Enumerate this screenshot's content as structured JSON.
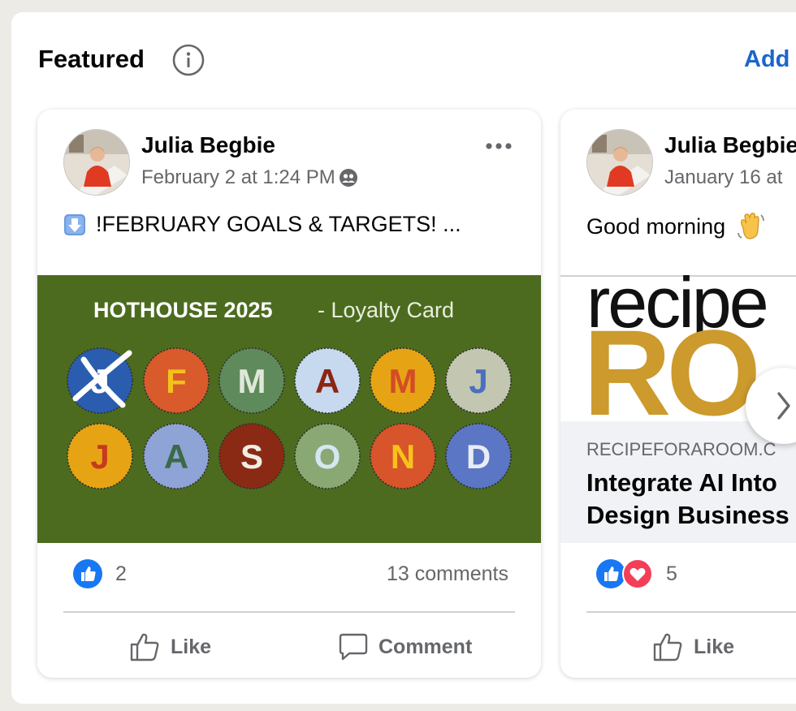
{
  "header": {
    "title": "Featured",
    "info_icon": "info-icon",
    "add_label": "Add"
  },
  "cards": [
    {
      "author": "Julia Begbie",
      "date": "February 2 at 1:24 PM",
      "privacy_icon": "friends-icon",
      "text": "!FEBRUARY GOALS & TARGETS! ...",
      "text_emoji_icon": "down-arrow-emoji",
      "media": {
        "title_bold": "HOTHOUSE 2025",
        "title_rest": "- Loyalty Card",
        "background": "#4c6b1f",
        "months": [
          {
            "letter": "J",
            "color": "#2a5db0",
            "text": "#2a5db0",
            "crossed": true
          },
          {
            "letter": "F",
            "color": "#d95a2b",
            "text": "#f2c11c"
          },
          {
            "letter": "M",
            "color": "#5f8a5c",
            "text": "#dfe8d8"
          },
          {
            "letter": "A",
            "color": "#c7d9ef",
            "text": "#8b2612"
          },
          {
            "letter": "M",
            "color": "#e6a414",
            "text": "#d24d26"
          },
          {
            "letter": "J",
            "color": "#c3c6b0",
            "text": "#4a6ec0"
          },
          {
            "letter": "J",
            "color": "#e6a414",
            "text": "#c63a1f"
          },
          {
            "letter": "A",
            "color": "#8ea3d6",
            "text": "#3b6a46"
          },
          {
            "letter": "S",
            "color": "#8a2a14",
            "text": "#f1ede4"
          },
          {
            "letter": "O",
            "color": "#8aa873",
            "text": "#d6e6f3"
          },
          {
            "letter": "N",
            "color": "#d8542a",
            "text": "#f6c21b"
          },
          {
            "letter": "D",
            "color": "#5a76c4",
            "text": "#e8ecf6"
          }
        ]
      },
      "reactions_count": "2",
      "comments": "13 comments",
      "like_label": "Like",
      "comment_label": "Comment"
    },
    {
      "author": "Julia Begbie",
      "date": "January 16 at",
      "text": "Good morning",
      "text_emoji_icon": "waving-hand-emoji",
      "link": {
        "image_word_top": "recipe",
        "image_word_bottom": "RO",
        "domain": "RECIPEFORAROOM.C",
        "title_line1": "Integrate AI Into",
        "title_line2": "Design Business"
      },
      "reactions_count": "5",
      "like_label": "Like"
    }
  ],
  "colors": {
    "accent": "#1b66c9",
    "like_blue": "#1877f2",
    "love_red": "#f33e58",
    "secondary_text": "#65676b"
  }
}
